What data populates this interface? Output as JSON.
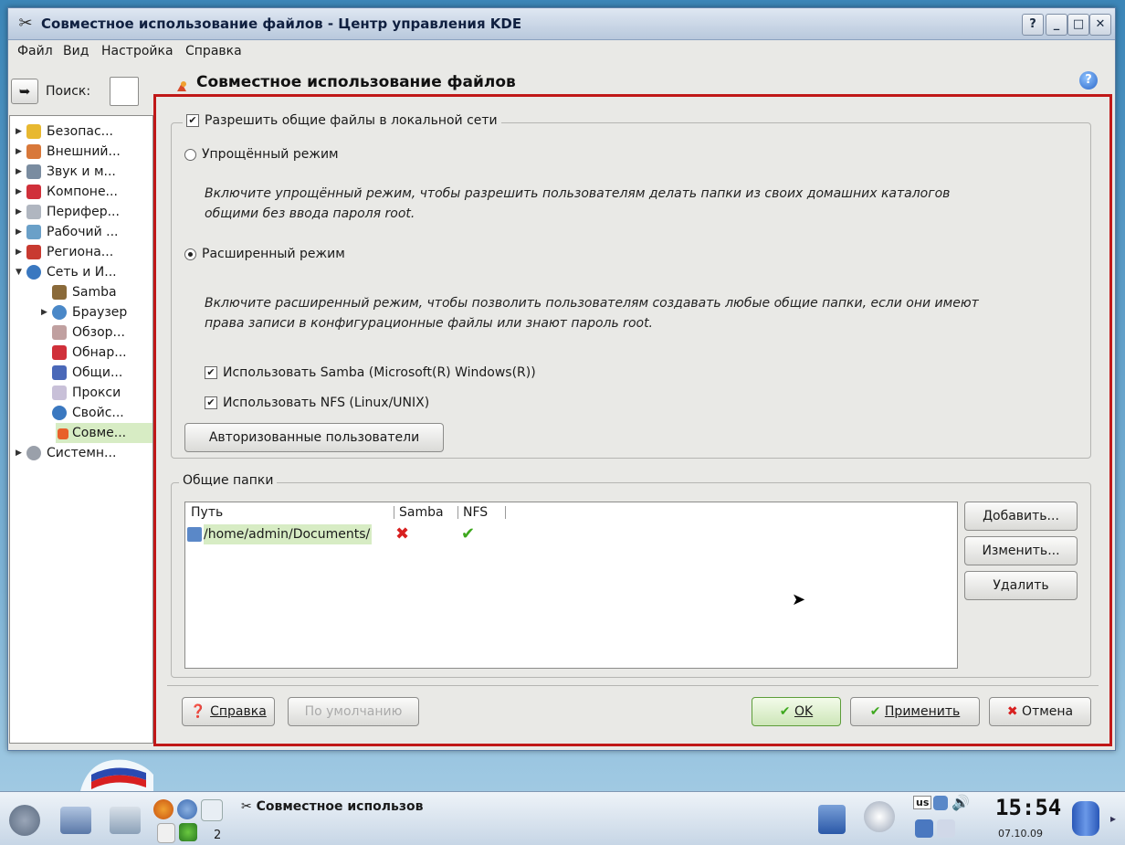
{
  "window": {
    "title": "Совместное использование файлов - Центр управления KDE",
    "btn_help": "?",
    "btn_min": "_",
    "btn_max": "□",
    "btn_close": "✕"
  },
  "menu": {
    "file": "Файл",
    "view": "Вид",
    "settings": "Настройка",
    "help": "Справка"
  },
  "search": {
    "label": "Поиск:"
  },
  "page": {
    "title": "Совместное использование файлов"
  },
  "sidebar": {
    "items": [
      {
        "label": "Безопас..."
      },
      {
        "label": "Внешний..."
      },
      {
        "label": "Звук и м..."
      },
      {
        "label": "Компоне..."
      },
      {
        "label": "Перифер..."
      },
      {
        "label": "Рабочий ..."
      },
      {
        "label": "Региона..."
      },
      {
        "label": "Сеть и И..."
      },
      {
        "label": "Samba"
      },
      {
        "label": "Браузер"
      },
      {
        "label": "Обзор..."
      },
      {
        "label": "Обнар..."
      },
      {
        "label": "Общи..."
      },
      {
        "label": "Прокси"
      },
      {
        "label": "Свойс..."
      },
      {
        "label": "Совме..."
      },
      {
        "label": "Системн..."
      }
    ]
  },
  "sharing": {
    "enable_label": "Разрешить общие файлы в локальной сети",
    "enable_checked": true,
    "simple_mode": "Упрощённый режим",
    "simple_desc_1": "Включите упрощённый режим, чтобы разрешить пользователям делать папки из своих домашних каталогов",
    "simple_desc_2": "общими без ввода пароля root.",
    "advanced_mode": "Расширенный режим",
    "advanced_selected": true,
    "advanced_desc_1": "Включите расширенный режим, чтобы позволить пользователям создавать любые общие папки, если они имеют",
    "advanced_desc_2": "права записи в конфигурационные файлы или знают пароль root.",
    "use_samba": "Использовать Samba (Microsoft(R) Windows(R))",
    "use_nfs": "Использовать NFS (Linux/UNIX)",
    "authorized_users": "Авторизованные пользователи"
  },
  "folders": {
    "legend": "Общие папки",
    "columns": [
      "Путь",
      "Samba",
      "NFS"
    ],
    "rows": [
      {
        "path": "/home/admin/Documents/",
        "samba": false,
        "nfs": true
      }
    ],
    "add": "Добавить...",
    "edit": "Изменить...",
    "remove": "Удалить"
  },
  "buttons": {
    "help": "Справка",
    "defaults": "По умолчанию",
    "ok": "OK",
    "apply": "Применить",
    "cancel": "Отмена"
  },
  "taskbar": {
    "task_label": "Совместное использов",
    "desktop_num": "2",
    "keyboard": "us",
    "clock": "15:54",
    "date": "07.10.09"
  },
  "colors": {
    "accent_red": "#c01818",
    "selected_green": "#d7ecc4"
  }
}
